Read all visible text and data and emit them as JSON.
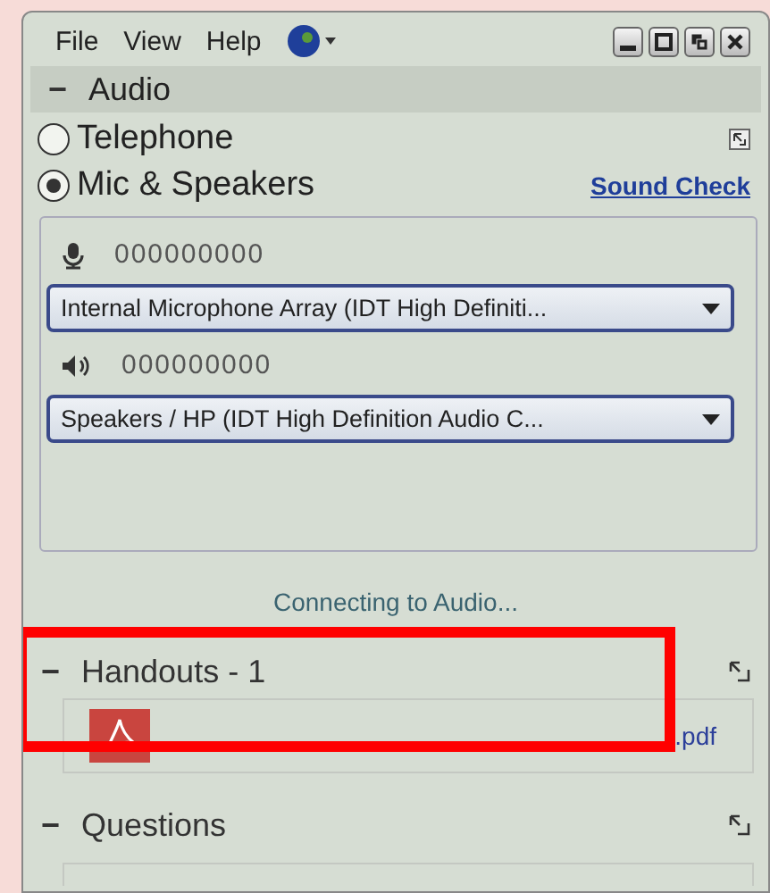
{
  "menu": [
    "File",
    "View",
    "Help"
  ],
  "audio": {
    "collapse": "−",
    "title": "Audio",
    "options": [
      {
        "label": "Telephone",
        "selected": false
      },
      {
        "label": "Mic & Speakers",
        "selected": true
      }
    ],
    "sound_check": "Sound Check",
    "devices": [
      {
        "kind": "microphone",
        "meter": "000000000",
        "value": "Internal Microphone Array (IDT High Definiti..."
      },
      {
        "kind": "speaker",
        "meter": "000000000",
        "value": "Speakers / HP (IDT High Definition Audio C..."
      }
    ],
    "status": "Connecting to Audio..."
  },
  "handouts": {
    "collapse": "−",
    "title": "Handouts - 1",
    "files": [
      {
        "name": ".pdf"
      }
    ]
  },
  "questions": {
    "collapse": "−",
    "title": "Questions"
  }
}
